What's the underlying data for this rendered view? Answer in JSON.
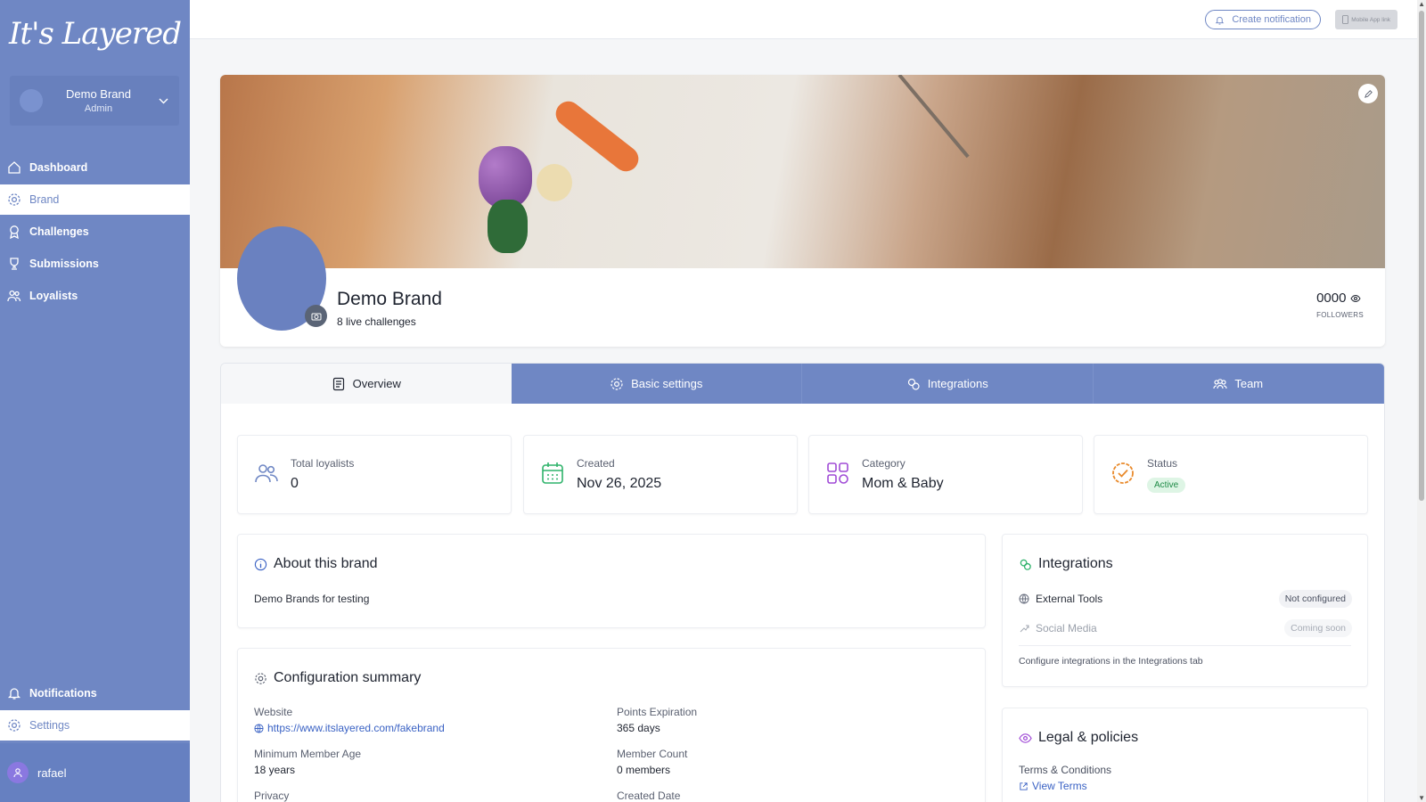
{
  "sidebar": {
    "logo": "It's Layered",
    "brand_switch": {
      "name": "Demo Brand",
      "role": "Admin"
    },
    "items": [
      {
        "label": "Dashboard",
        "icon": "home-icon"
      },
      {
        "label": "Brand",
        "icon": "gear-icon"
      },
      {
        "label": "Challenges",
        "icon": "award-icon"
      },
      {
        "label": "Submissions",
        "icon": "trophy-icon"
      },
      {
        "label": "Loyalists",
        "icon": "users-icon"
      }
    ],
    "bottom_items": [
      {
        "label": "Notifications",
        "icon": "bell-icon"
      },
      {
        "label": "Settings",
        "icon": "gear-icon"
      }
    ],
    "user": {
      "name": "rafael"
    }
  },
  "topbar": {
    "create_notification": "Create notification",
    "mobile_app_link": "Mobile App link"
  },
  "profile": {
    "name": "Demo Brand",
    "live_challenges": "8 live challenges",
    "followers_value": "0000",
    "followers_label": "FOLLOWERS"
  },
  "tabs": [
    {
      "label": "Overview"
    },
    {
      "label": "Basic settings"
    },
    {
      "label": "Integrations"
    },
    {
      "label": "Team"
    }
  ],
  "stats": {
    "total_loyalists": {
      "label": "Total loyalists",
      "value": "0"
    },
    "created": {
      "label": "Created",
      "value": "Nov 26, 2025"
    },
    "category": {
      "label": "Category",
      "value": "Mom & Baby"
    },
    "status": {
      "label": "Status",
      "value": "Active"
    }
  },
  "about": {
    "title": "About this brand",
    "text": "Demo Brands for testing"
  },
  "config": {
    "title": "Configuration summary",
    "website_label": "Website",
    "website_value": "https://www.itslayered.com/fakebrand",
    "min_age_label": "Minimum Member Age",
    "min_age_value": "18 years",
    "privacy_label": "Privacy",
    "points_exp_label": "Points Expiration",
    "points_exp_value": "365 days",
    "member_count_label": "Member Count",
    "member_count_value": "0 members",
    "created_date_label": "Created Date"
  },
  "integrations": {
    "title": "Integrations",
    "rows": [
      {
        "label": "External Tools",
        "status": "Not configured"
      },
      {
        "label": "Social Media",
        "status": "Coming soon"
      }
    ],
    "note": "Configure integrations in the Integrations tab"
  },
  "legal": {
    "title": "Legal & policies",
    "terms_label": "Terms & Conditions",
    "terms_link": "View Terms"
  },
  "colors": {
    "sidebar": "#6f87c4",
    "accent": "#6f87c4",
    "link": "#3a62c4",
    "active_badge": "#1e8a46"
  }
}
